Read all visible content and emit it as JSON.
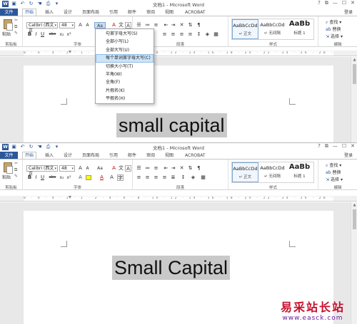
{
  "app": {
    "title": "文档1 - Microsoft Word",
    "login": "登录",
    "window_controls": [
      "?",
      "⧉",
      "—",
      "☐",
      "✕"
    ]
  },
  "tabs": [
    "文件",
    "开始",
    "插入",
    "设计",
    "页面布局",
    "引用",
    "邮件",
    "审阅",
    "视图",
    "ACROBAT"
  ],
  "ribbon": {
    "clipboard": {
      "paste": "粘贴",
      "label": "剪贴板"
    },
    "font": {
      "family": "Calibri (西文正",
      "size": "48",
      "case_button": "Aa",
      "label": "字体",
      "format_buttons": [
        "B",
        "I",
        "U",
        "abc",
        "x₂",
        "x²"
      ]
    },
    "paragraph": {
      "label": "段落"
    },
    "styles": {
      "label": "样式",
      "items": [
        {
          "preview": "AaBbCcDd",
          "name": "↵ 正文"
        },
        {
          "preview": "AaBbCcDd",
          "name": "↵ 无间隔"
        },
        {
          "preview": "AaBb",
          "name": "标题 1"
        }
      ]
    },
    "editing": {
      "label": "编辑",
      "items": [
        {
          "icon": "⌕",
          "label": "查找 ▾"
        },
        {
          "icon": "ab",
          "label": "替换"
        },
        {
          "icon": "⇲",
          "label": "选择 ▾"
        }
      ]
    }
  },
  "ruler_text": "8 · 6 · 4 · 2 · 1 · 2 · 4 · 6 · 8 · 10 · 12 · 14 · 16 · 18 · 20 · 22 · 24 · 26 · 28 · 30 · 32 · 34 · 36 · 38 · 40 · 42",
  "case_menu": {
    "items": [
      "句首字母大写(S)",
      "全部小写(L)",
      "全部大写(U)",
      "每个单词首字母大写(C)",
      "切换大小写(T)",
      "半角(W)",
      "全角(F)",
      "片假名(K)",
      "平假名(H)"
    ],
    "highlighted_index": 3
  },
  "documents": {
    "top_text": "small capital",
    "bottom_text": "Small Capital"
  },
  "watermark": {
    "cn": "易采站长站",
    "url": "www.easck.com"
  },
  "colors": {
    "file_tab": "#2b579a",
    "selection": "#c9c9c9",
    "menu_hover": "#cde4f7",
    "font_color": "#c00000",
    "highlight": "#ffff00"
  }
}
